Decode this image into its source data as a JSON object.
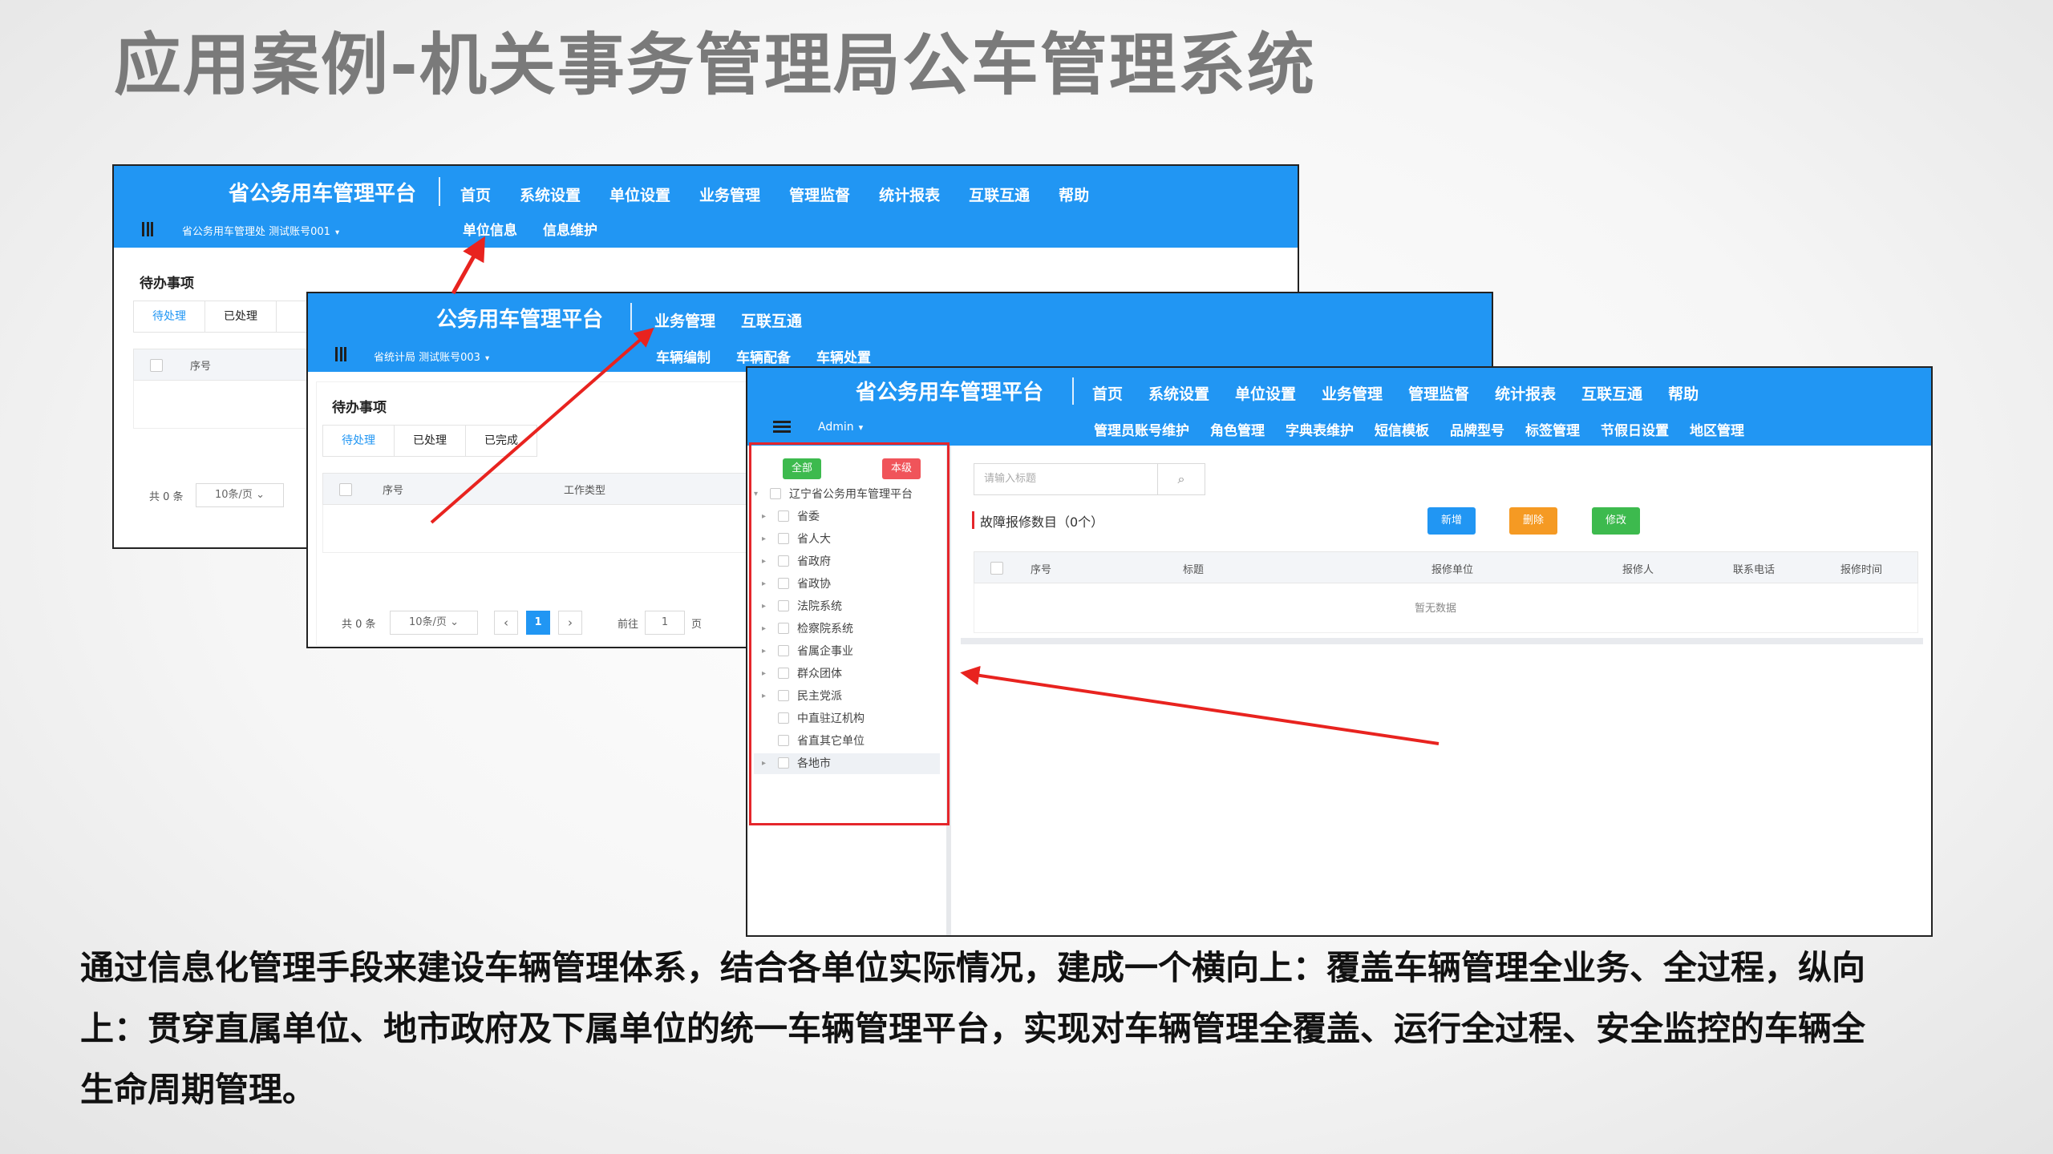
{
  "slide_title": "应用案例-机关事务管理局公车管理系统",
  "caption_lines": [
    "通过信息化管理手段来建设车辆管理体系，结合各单位实际情况，建成一个横向上：覆盖车辆管理全业务、全过程，纵向",
    "上：贯穿直属单位、地市政府及下属单位的统一车辆管理平台，实现对车辆管理全覆盖、运行全过程、安全监控的车辆全",
    "生命周期管理。"
  ],
  "colors": {
    "topbar": "#2196f3",
    "arrow": "#e8231f",
    "red_frame": "#e5262b"
  },
  "shot1": {
    "brand": "省公务用车管理平台",
    "menu": [
      "首页",
      "系统设置",
      "单位设置",
      "业务管理",
      "管理监督",
      "统计报表",
      "互联互通",
      "帮助"
    ],
    "submenu": [
      "单位信息",
      "信息维护"
    ],
    "account": "省公务用车管理处 测试账号001",
    "pending_title": "待办事项",
    "tabs": [
      "待处理",
      "已处理",
      "已"
    ],
    "col_index": "序号",
    "total": "共 0 条",
    "page_size": "10条/页"
  },
  "shot2": {
    "brand": "公务用车管理平台",
    "menu": [
      "业务管理",
      "互联互通"
    ],
    "submenu": [
      "车辆编制",
      "车辆配备",
      "车辆处置"
    ],
    "account": "省统计局 测试账号003",
    "pending_title": "待办事项",
    "tabs": [
      "待处理",
      "已处理",
      "已完成"
    ],
    "col_index": "序号",
    "col_type": "工作类型",
    "total": "共 0 条",
    "page_size": "10条/页",
    "prev": "‹",
    "page_current": "1",
    "next": "›",
    "goto_label": "前往",
    "goto_value": "1",
    "page_unit": "页"
  },
  "shot3": {
    "brand": "省公务用车管理平台",
    "menu": [
      "首页",
      "系统设置",
      "单位设置",
      "业务管理",
      "管理监督",
      "统计报表",
      "互联互通",
      "帮助"
    ],
    "submenu": [
      "管理员账号维护",
      "角色管理",
      "字典表维护",
      "短信模板",
      "品牌型号",
      "标签管理",
      "节假日设置",
      "地区管理"
    ],
    "account": "Admin",
    "btn_all": "全部",
    "btn_level": "本级",
    "tree_root": "辽宁省公务用车管理平台",
    "tree_items": [
      "省委",
      "省人大",
      "省政府",
      "省政协",
      "法院系统",
      "检察院系统",
      "省属企事业",
      "群众团体",
      "民主党派",
      "中直驻辽机构",
      "省直其它单位",
      "各地市"
    ],
    "search_placeholder": "请输入标题",
    "list_title": "故障报修数目（0个）",
    "btn_new": "新增",
    "btn_delete": "删除",
    "btn_edit": "修改",
    "columns": [
      "序号",
      "标题",
      "报修单位",
      "报修人",
      "联系电话",
      "报修时间"
    ],
    "empty": "暂无数据"
  }
}
